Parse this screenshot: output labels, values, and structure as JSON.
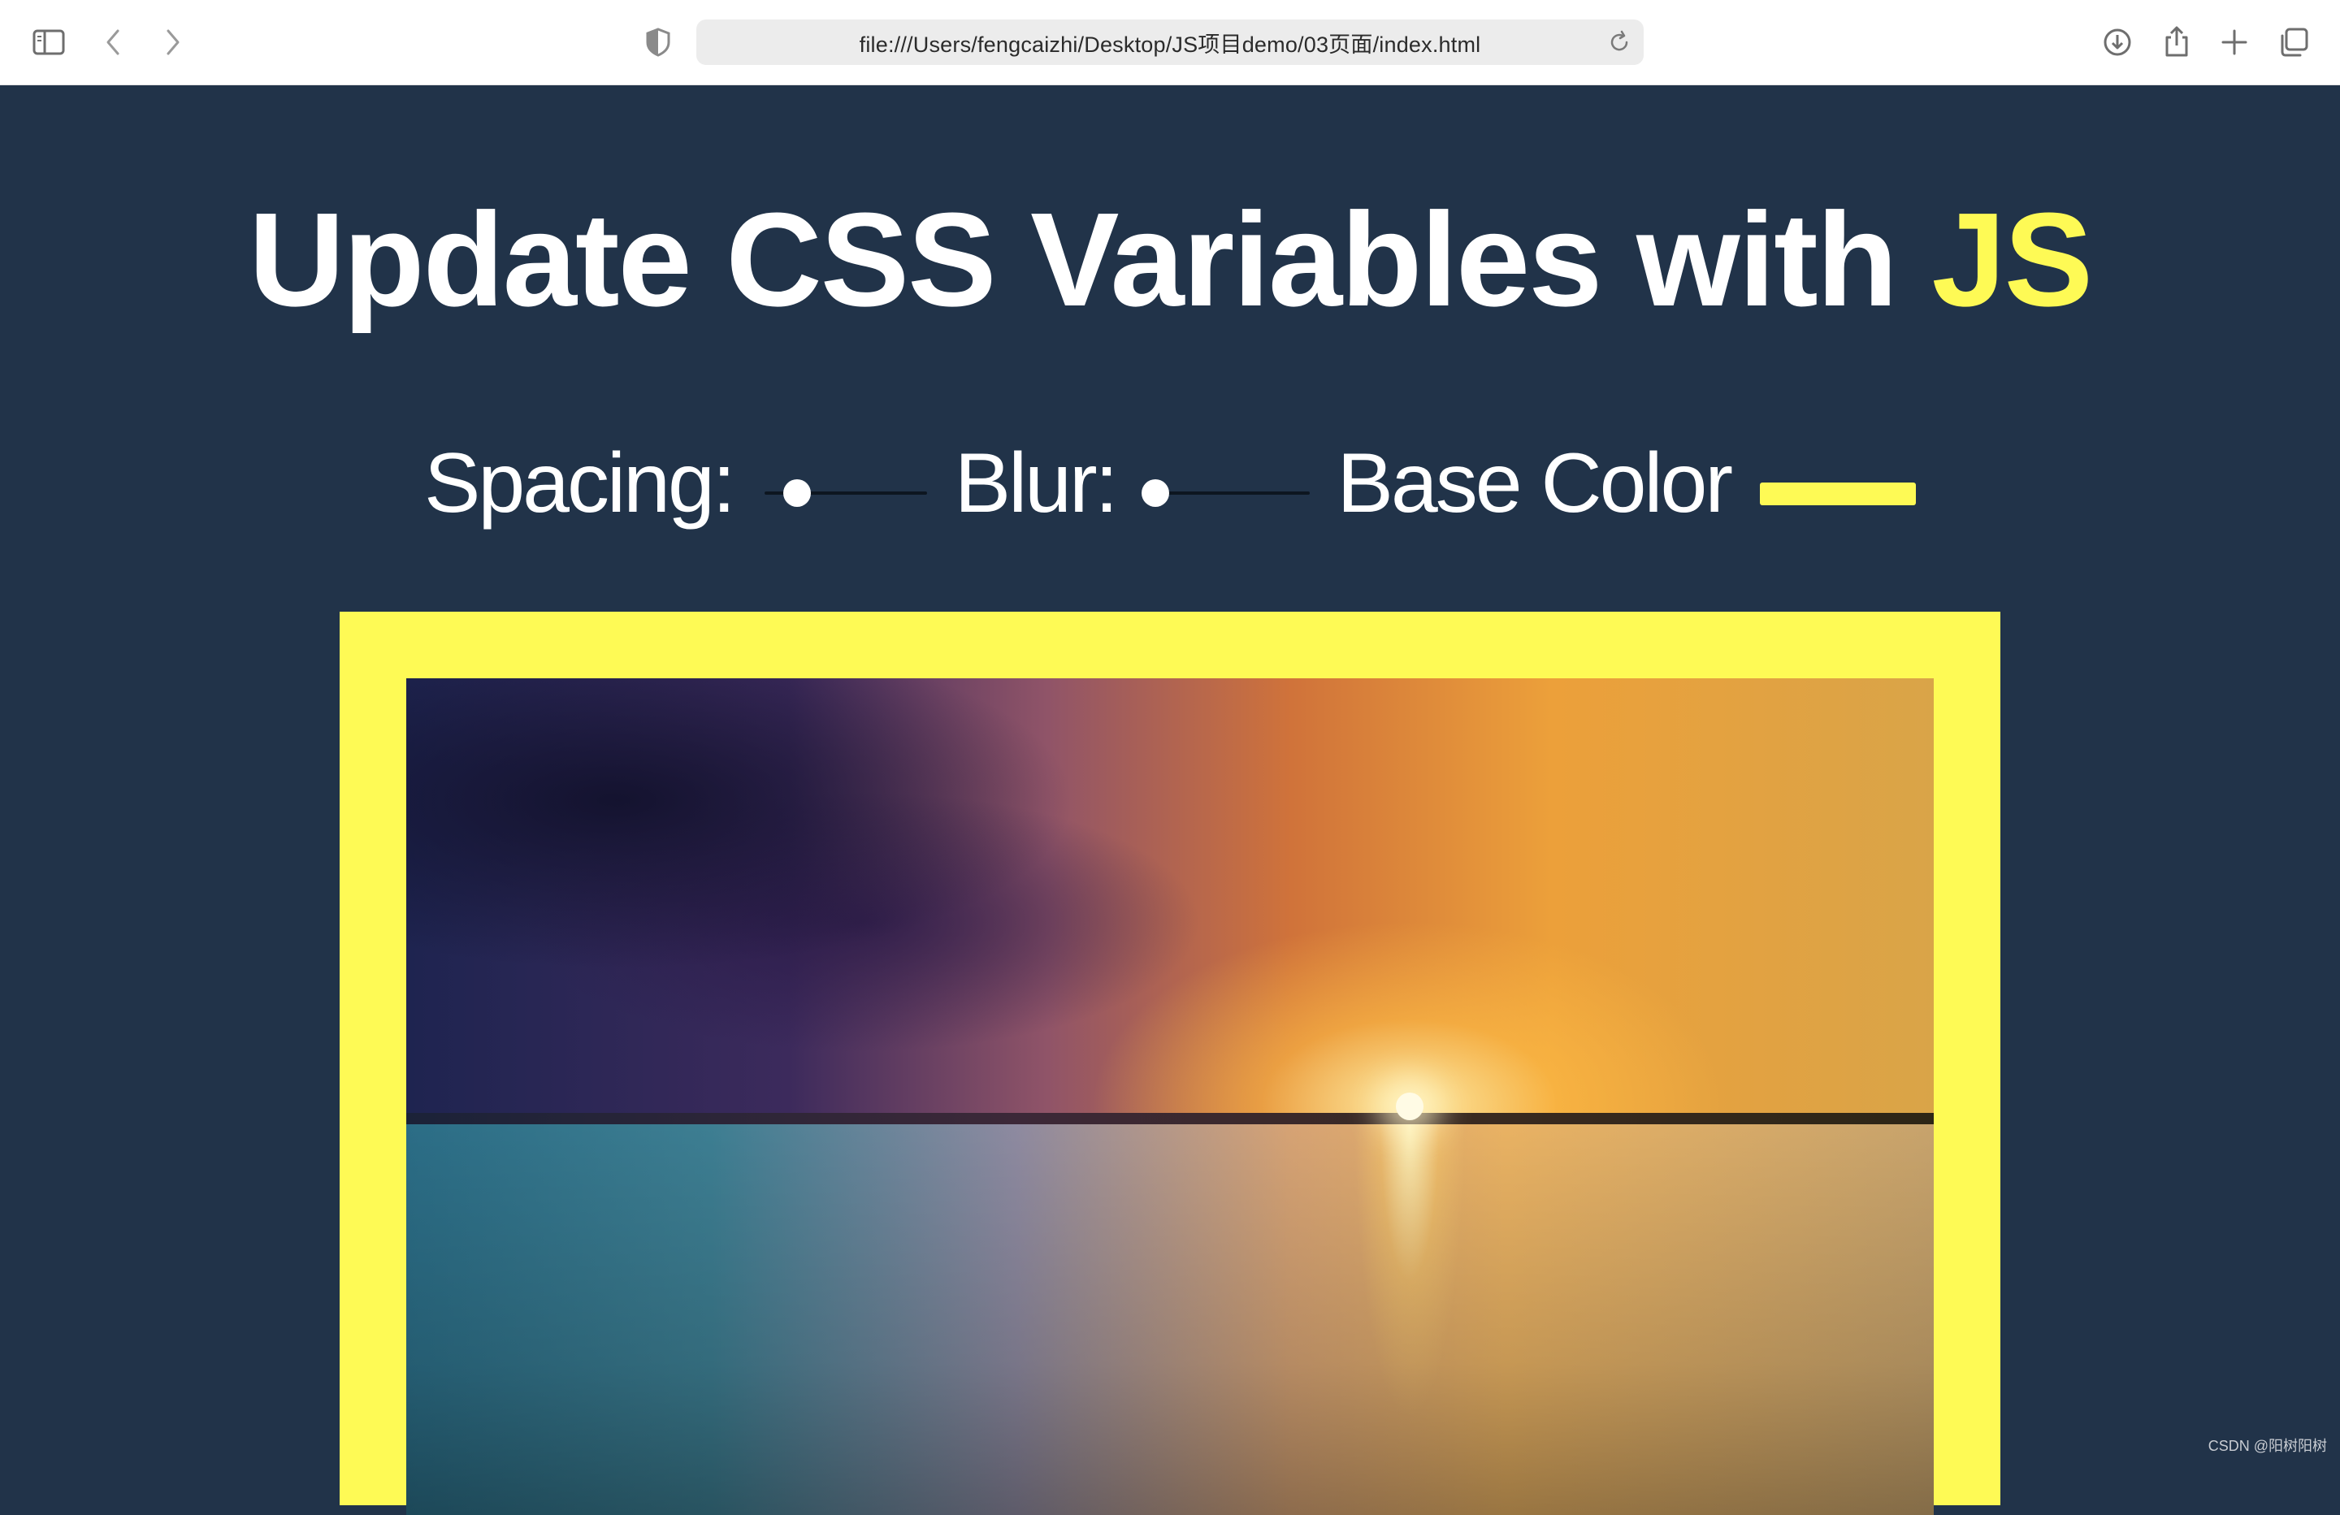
{
  "browser": {
    "url": "file:///Users/fengcaizhi/Desktop/JS项目demo/03页面/index.html",
    "icons": [
      "sidebar-icon",
      "back-icon",
      "forward-icon",
      "privacy-shield-icon",
      "reload-icon",
      "download-icon",
      "share-icon",
      "new-tab-icon",
      "tab-overview-icon"
    ]
  },
  "page": {
    "title_main": "Update CSS Variables with ",
    "title_highlight": "JS",
    "controls": {
      "spacing_label": "Spacing:",
      "spacing_value": 0.2,
      "blur_label": "Blur:",
      "blur_value": 0.05,
      "base_label": "Base Color",
      "base_color": "#fefa55"
    },
    "image": "sunset over water",
    "background_color": "#213349",
    "accent_color": "#fefa55"
  },
  "watermark": "CSDN @阳树阳树"
}
